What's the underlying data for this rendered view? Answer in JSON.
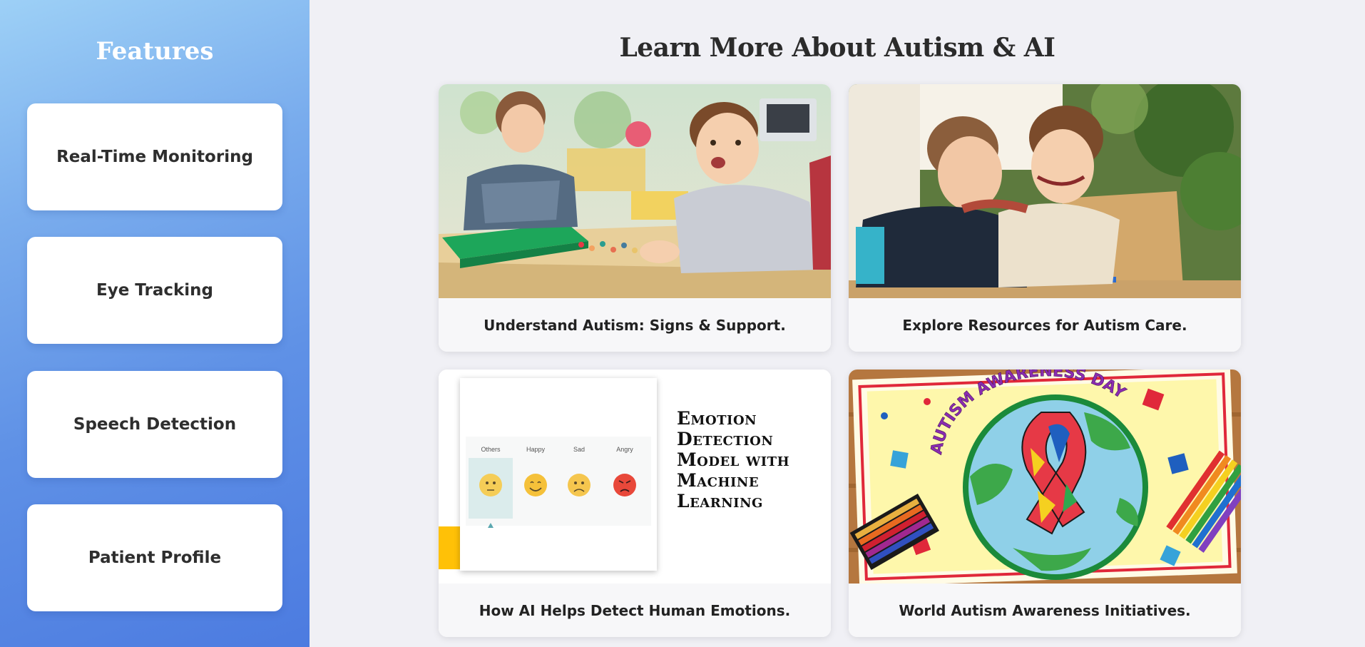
{
  "sidebar": {
    "title": "Features",
    "items": [
      {
        "label": "Real-Time Monitoring"
      },
      {
        "label": "Eye Tracking"
      },
      {
        "label": "Speech Detection"
      },
      {
        "label": "Patient Profile"
      }
    ]
  },
  "main": {
    "title": "Learn More About Autism & AI",
    "cards": [
      {
        "caption": "Understand Autism: Signs & Support."
      },
      {
        "caption": "Explore Resources for Autism Care."
      },
      {
        "caption": "How AI Helps Detect Human Emotions."
      },
      {
        "caption": "World Autism Awareness Initiatives."
      }
    ],
    "emotion_card": {
      "heading_lines": [
        "Emotion",
        "Detection",
        "Model with",
        "Machine",
        "Learning"
      ],
      "labels": [
        "Others",
        "Happy",
        "Sad",
        "Angry"
      ]
    },
    "awareness_card": {
      "poster_text": "AUTISM AWARENESS DAY"
    }
  },
  "colors": {
    "sidebar_gradient": [
      "#9dd0f6",
      "#4c7be0"
    ],
    "page_background": "#f0f0f5",
    "card_background": "#ffffff",
    "emotion_accent": "#ffc107"
  }
}
